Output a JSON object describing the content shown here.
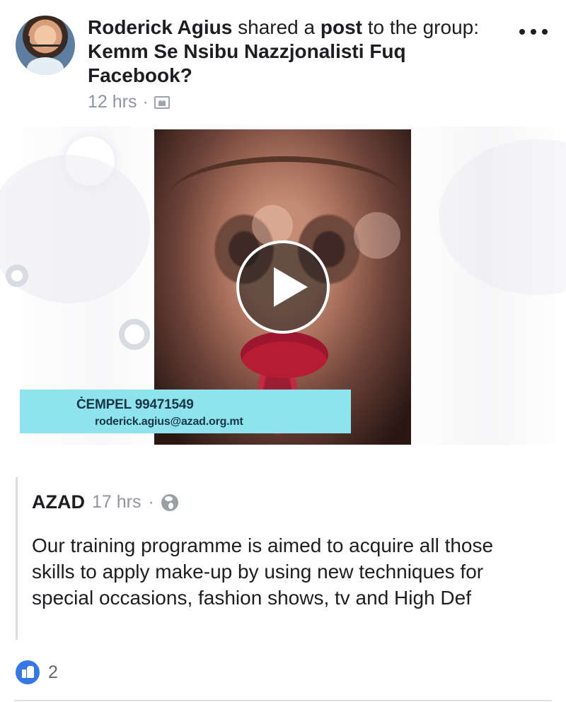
{
  "post": {
    "author": "Roderick Agius",
    "action_prefix": "shared a",
    "object": "post",
    "action_suffix": "to the",
    "group_label": "group:",
    "group_name": "Kemm Se Nsibu Nazzjonalisti Fuq Facebook?",
    "timestamp": "12 hrs",
    "separator": "·",
    "audience_icon": "group-icon",
    "menu_icon": "more-options-icon"
  },
  "media": {
    "play_icon": "play-icon",
    "contact_phone": "ĊEMPEL 99471549",
    "contact_email": "roderick.agius@azad.org.mt"
  },
  "shared": {
    "author": "AZAD",
    "timestamp": "17 hrs",
    "separator": "·",
    "audience_icon": "globe-icon",
    "text": "Our training programme is aimed to acquire all those skills to apply make-up by using new techniques for special occasions, fashion shows, tv and High Def"
  },
  "reactions": {
    "icon": "like-icon",
    "count": "2"
  }
}
